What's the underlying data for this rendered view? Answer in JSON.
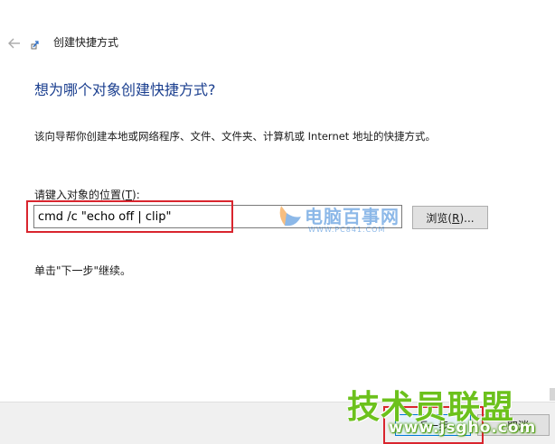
{
  "window": {
    "title": "创建快捷方式"
  },
  "page": {
    "heading": "想为哪个对象创建快捷方式?",
    "description": "该向导帮你创建本地或网络程序、文件、文件夹、计算机或 Internet 地址的快捷方式。",
    "location_label": "请键入对象的位置(",
    "location_label_key": "T",
    "location_label_tail": "):",
    "location_value": "cmd /c \"echo off | clip\"",
    "browse_label": "浏览(",
    "browse_key": "R",
    "browse_tail": ")...",
    "continue_hint": "单击\"下一步\"继续。"
  },
  "footer": {
    "next_label": "下一步",
    "cancel_label": "取消"
  },
  "watermarks": {
    "mid_text": "电脑百事网",
    "mid_url": "WWW.PC841.COM",
    "bottom_text": "技术员联盟",
    "bottom_url": "www.jsgho.com"
  },
  "icons": {
    "back": "back-arrow-icon",
    "wizard": "shortcut-wizard-icon"
  },
  "colors": {
    "heading": "#1b3f8f",
    "highlight": "#d9252e",
    "watermark_green": "#6cc11c",
    "watermark_blue": "#2f7fd6",
    "primary_border": "#0078d7"
  }
}
